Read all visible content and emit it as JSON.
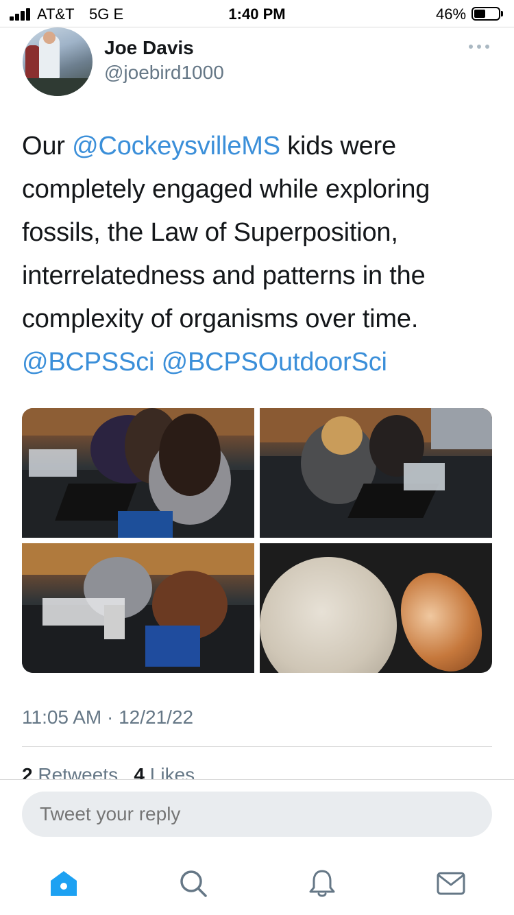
{
  "status_bar": {
    "carrier": "AT&T",
    "network": "5G E",
    "time": "1:40 PM",
    "battery_percent": "46%"
  },
  "tweet": {
    "author": {
      "display_name": "Joe Davis",
      "handle": "@joebird1000"
    },
    "text": {
      "part1": "Our ",
      "mention1": "@CockeysvilleMS",
      "part2": " kids were completely engaged while exploring fossils, the Law of Superposition, interrelatedness and patterns in the complexity of organisms over time. ",
      "mention2": "@BCPSSci",
      "part3": " ",
      "mention3": "@BCPSOutdoorSci"
    },
    "timestamp": "11:05 AM · 12/21/22",
    "stats": {
      "retweets_count": "2",
      "retweets_label": "Retweets",
      "likes_count": "4",
      "likes_label": "Likes"
    }
  },
  "reply": {
    "placeholder": "Tweet your reply"
  },
  "tab_bar": {
    "icons": [
      "home-icon",
      "search-icon",
      "notifications-icon",
      "messages-icon"
    ],
    "active_color": "#1da1f2",
    "inactive_color": "#657786"
  },
  "colors": {
    "link": "#3b8fd9",
    "text": "#14171a",
    "secondary": "#657786"
  }
}
